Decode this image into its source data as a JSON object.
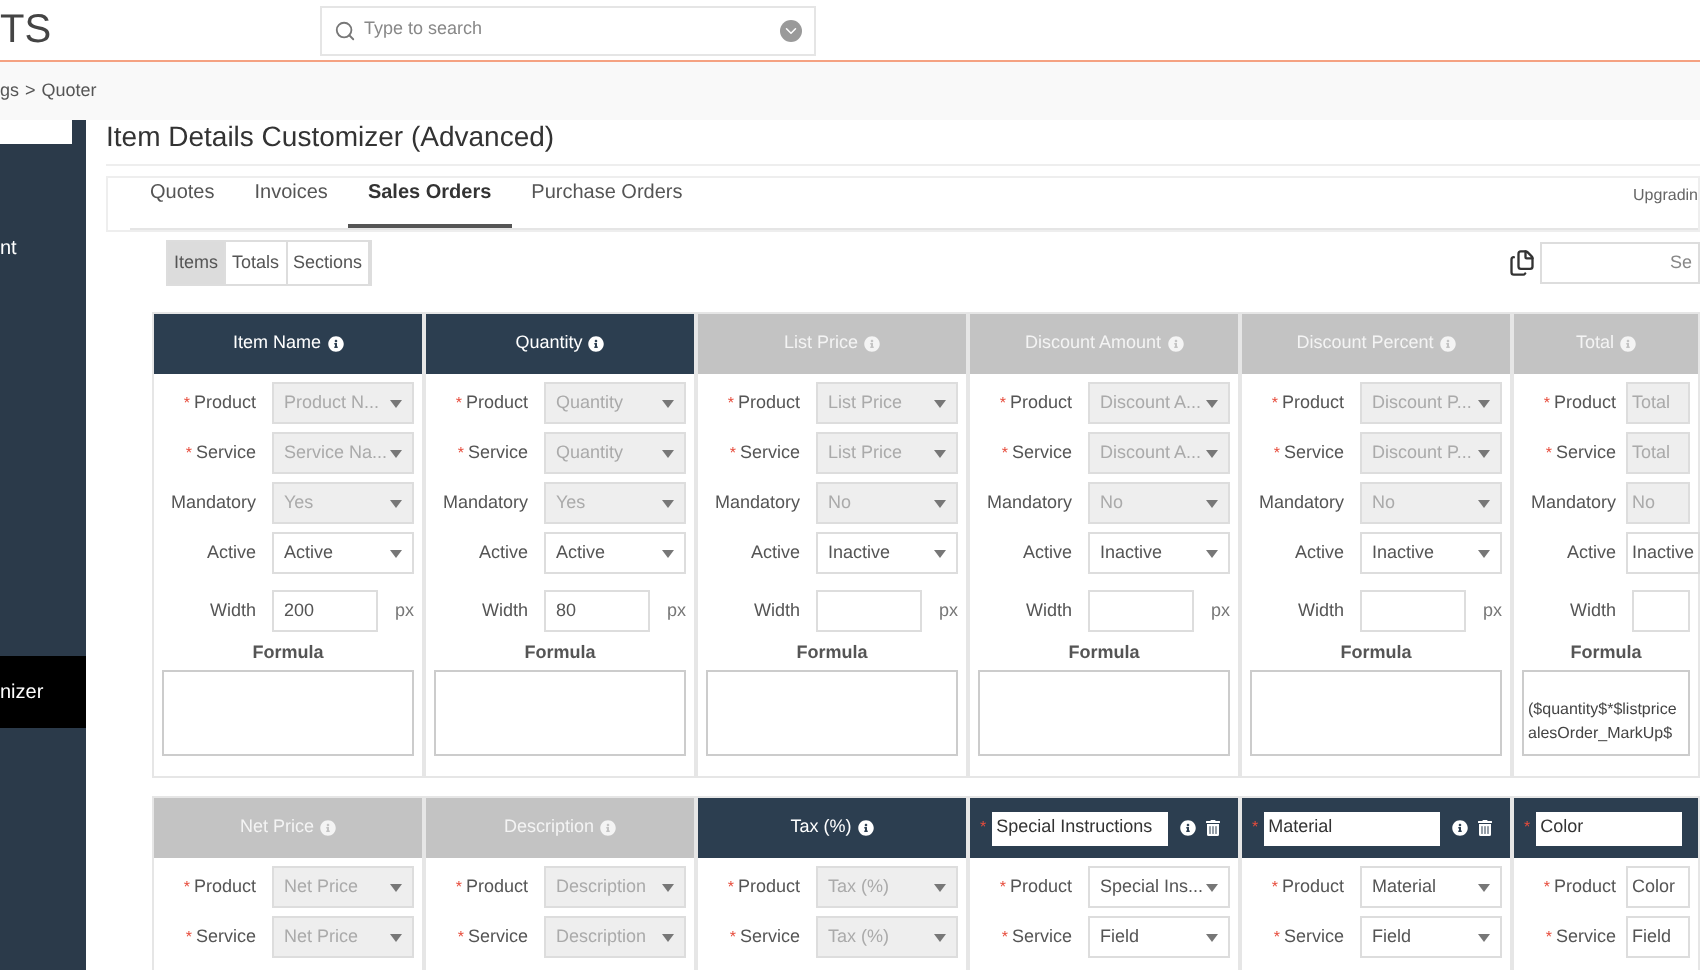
{
  "header": {
    "logo": "TS",
    "search": {
      "placeholder": "Type to search"
    }
  },
  "breadcrumb": {
    "items": [
      "gs",
      "Quoter"
    ],
    "separator": ">"
  },
  "sidebar": {
    "items": [
      {
        "label": "nt",
        "selected": false
      },
      {
        "label": "nizer",
        "selected": true
      }
    ]
  },
  "page": {
    "title": "Item Details Customizer (Advanced)"
  },
  "tabs": [
    {
      "label": "Quotes",
      "selected": false
    },
    {
      "label": "Invoices",
      "selected": false
    },
    {
      "label": "Sales Orders",
      "selected": true
    },
    {
      "label": "Purchase Orders",
      "selected": false
    }
  ],
  "notice": "Upgradin",
  "segments": [
    {
      "label": "Items",
      "selected": true
    },
    {
      "label": "Totals",
      "selected": false
    },
    {
      "label": "Sections",
      "selected": false
    }
  ],
  "column_search": {
    "placeholder": "Se"
  },
  "column_groups": [
    {
      "columns": [
        {
          "kind": "standard",
          "title": "Item Name",
          "active": true,
          "fields": [
            {
              "kind": "select",
              "label": "Product",
              "required_mark": "*",
              "value": "Product N...",
              "disabled": true
            },
            {
              "kind": "select",
              "label": "Service",
              "required_mark": "*",
              "value": "Service Na...",
              "disabled": true
            },
            {
              "kind": "select",
              "label": "Mandatory",
              "value": "Yes",
              "disabled": true
            },
            {
              "kind": "select",
              "label": "Active",
              "value": "Active",
              "disabled": false
            },
            {
              "kind": "number",
              "label": "Width",
              "value": "200",
              "unit": "px"
            },
            {
              "kind": "formula",
              "label": "Formula"
            }
          ]
        },
        {
          "kind": "standard",
          "title": "Quantity",
          "active": true,
          "fields": [
            {
              "kind": "select",
              "label": "Product",
              "required_mark": "*",
              "value": "Quantity",
              "disabled": true
            },
            {
              "kind": "select",
              "label": "Service",
              "required_mark": "*",
              "value": "Quantity",
              "disabled": true
            },
            {
              "kind": "select",
              "label": "Mandatory",
              "value": "Yes",
              "disabled": true
            },
            {
              "kind": "select",
              "label": "Active",
              "value": "Active",
              "disabled": false
            },
            {
              "kind": "number",
              "label": "Width",
              "value": "80",
              "unit": "px"
            },
            {
              "kind": "formula",
              "label": "Formula"
            }
          ]
        },
        {
          "kind": "standard",
          "title": "List Price",
          "active": false,
          "fields": [
            {
              "kind": "select",
              "label": "Product",
              "required_mark": "*",
              "value": "List Price",
              "disabled": true
            },
            {
              "kind": "select",
              "label": "Service",
              "required_mark": "*",
              "value": "List Price",
              "disabled": true
            },
            {
              "kind": "select",
              "label": "Mandatory",
              "value": "No",
              "disabled": true
            },
            {
              "kind": "select",
              "label": "Active",
              "value": "Inactive",
              "disabled": false
            },
            {
              "kind": "number",
              "label": "Width",
              "unit": "px"
            },
            {
              "kind": "formula",
              "label": "Formula"
            }
          ]
        },
        {
          "kind": "standard",
          "title": "Discount Amount",
          "active": false,
          "fields": [
            {
              "kind": "select",
              "label": "Product",
              "required_mark": "*",
              "value": "Discount A...",
              "disabled": true
            },
            {
              "kind": "select",
              "label": "Service",
              "required_mark": "*",
              "value": "Discount A...",
              "disabled": true
            },
            {
              "kind": "select",
              "label": "Mandatory",
              "value": "No",
              "disabled": true
            },
            {
              "kind": "select",
              "label": "Active",
              "value": "Inactive",
              "disabled": false
            },
            {
              "kind": "number",
              "label": "Width",
              "unit": "px"
            },
            {
              "kind": "formula",
              "label": "Formula"
            }
          ]
        },
        {
          "kind": "standard",
          "title": "Discount Percent",
          "active": false,
          "fields": [
            {
              "kind": "select",
              "label": "Product",
              "required_mark": "*",
              "value": "Discount P...",
              "disabled": true
            },
            {
              "kind": "select",
              "label": "Service",
              "required_mark": "*",
              "value": "Discount P...",
              "disabled": true
            },
            {
              "kind": "select",
              "label": "Mandatory",
              "value": "No",
              "disabled": true
            },
            {
              "kind": "select",
              "label": "Active",
              "value": "Inactive",
              "disabled": false
            },
            {
              "kind": "number",
              "label": "Width",
              "unit": "px"
            },
            {
              "kind": "formula",
              "label": "Formula"
            }
          ]
        },
        {
          "kind": "standard",
          "title": "Total",
          "active": false,
          "fields": [
            {
              "kind": "select",
              "label": "Product",
              "required_mark": "*",
              "value": "Total",
              "disabled": true
            },
            {
              "kind": "select",
              "label": "Service",
              "required_mark": "*",
              "value": "Total",
              "disabled": true
            },
            {
              "kind": "select",
              "label": "Mandatory",
              "value": "No",
              "disabled": true
            },
            {
              "kind": "select",
              "label": "Active",
              "value": "Inactive",
              "disabled": false
            },
            {
              "kind": "number",
              "label": "Width"
            },
            {
              "kind": "formula",
              "label": "Formula",
              "lines": [
                "($quantity$*$listprice",
                "alesOrder_MarkUp$"
              ]
            }
          ]
        }
      ]
    },
    {
      "columns": [
        {
          "kind": "standard",
          "title": "Net Price",
          "active": false,
          "fields": [
            {
              "kind": "select",
              "label": "Product",
              "required_mark": "*",
              "value": "Net Price",
              "disabled": true
            },
            {
              "kind": "select",
              "label": "Service",
              "required_mark": "*",
              "value": "Net Price",
              "disabled": true
            }
          ]
        },
        {
          "kind": "standard",
          "title": "Description",
          "active": false,
          "fields": [
            {
              "kind": "select",
              "label": "Product",
              "required_mark": "*",
              "value": "Description",
              "disabled": true
            },
            {
              "kind": "select",
              "label": "Service",
              "required_mark": "*",
              "value": "Description",
              "disabled": true
            }
          ]
        },
        {
          "kind": "standard",
          "title": "Tax (%)",
          "active": true,
          "fields": [
            {
              "kind": "select",
              "label": "Product",
              "required_mark": "*",
              "value": "Tax (%)",
              "disabled": true
            },
            {
              "kind": "select",
              "label": "Service",
              "required_mark": "*",
              "value": "Tax (%)",
              "disabled": true
            }
          ]
        },
        {
          "kind": "custom",
          "title": "Special Instructions",
          "active": true,
          "required_mark": "*",
          "fields": [
            {
              "kind": "select",
              "label": "Product",
              "required_mark": "*",
              "value": "Special Ins...",
              "disabled": false
            },
            {
              "kind": "select",
              "label": "Service",
              "required_mark": "*",
              "value": "Field",
              "disabled": false
            }
          ]
        },
        {
          "kind": "custom",
          "title": "Material",
          "active": true,
          "required_mark": "*",
          "fields": [
            {
              "kind": "select",
              "label": "Product",
              "required_mark": "*",
              "value": "Material",
              "disabled": false
            },
            {
              "kind": "select",
              "label": "Service",
              "required_mark": "*",
              "value": "Field",
              "disabled": false
            }
          ]
        },
        {
          "kind": "custom",
          "title": "Color",
          "active": true,
          "required_mark": "*",
          "fields": [
            {
              "kind": "select",
              "label": "Product",
              "required_mark": "*",
              "value": "Color",
              "disabled": false
            },
            {
              "kind": "select",
              "label": "Service",
              "required_mark": "*",
              "value": "Field",
              "disabled": false
            }
          ]
        }
      ]
    }
  ]
}
